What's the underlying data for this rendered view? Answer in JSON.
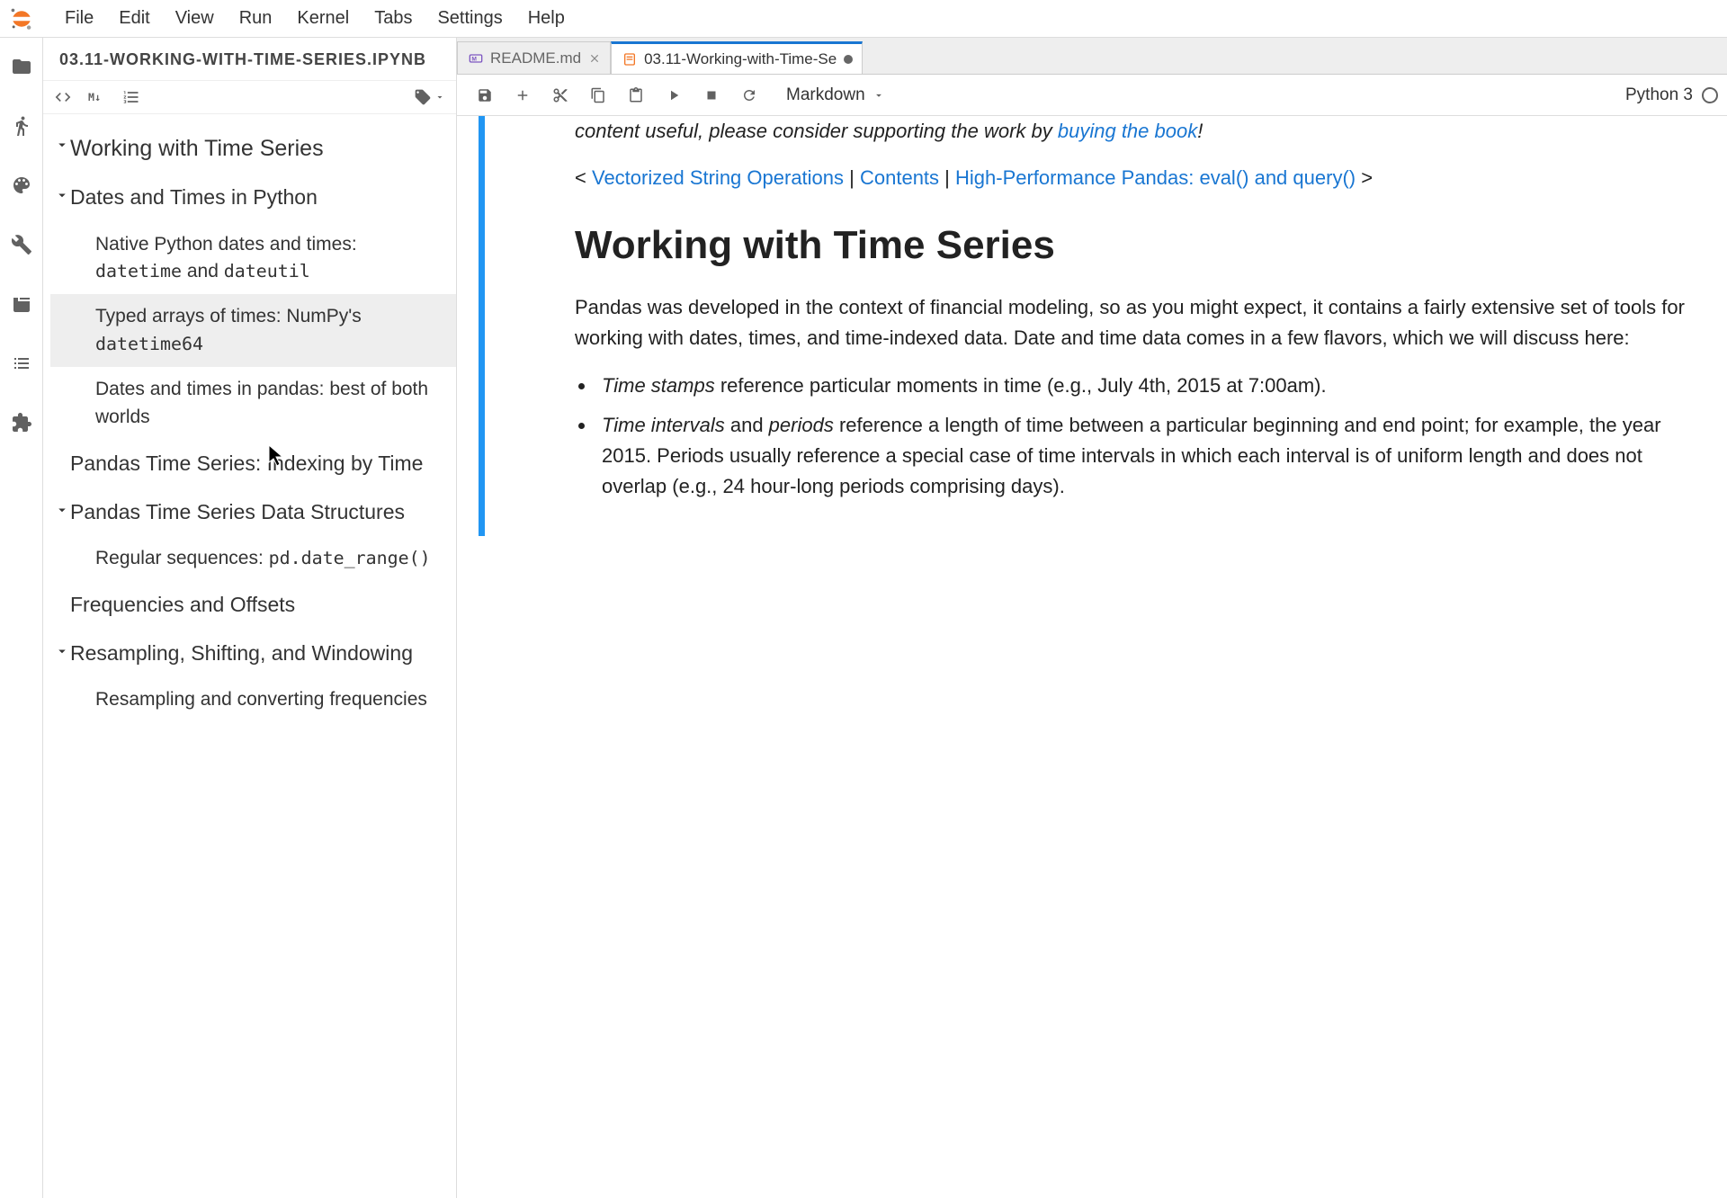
{
  "menubar": [
    "File",
    "Edit",
    "View",
    "Run",
    "Kernel",
    "Tabs",
    "Settings",
    "Help"
  ],
  "toc": {
    "title": "03.11-WORKING-WITH-TIME-SERIES.IPYNB",
    "entries": [
      {
        "level": 0,
        "caret": true,
        "html": "Working with Time Series"
      },
      {
        "level": 1,
        "caret": true,
        "html": "Dates and Times in Python"
      },
      {
        "level": 2,
        "caret": false,
        "html": "Native Python dates and times: <code class='toc-code'>datetime</code> and <code class='toc-code'>dateutil</code>"
      },
      {
        "level": 2,
        "caret": false,
        "selected": true,
        "html": "Typed arrays of times: NumPy's <code class='toc-code'>datetime64</code>"
      },
      {
        "level": 2,
        "caret": false,
        "html": "Dates and times in pandas: best of both worlds"
      },
      {
        "level": 1,
        "caret": false,
        "html": "Pandas Time Series: Indexing by Time"
      },
      {
        "level": 1,
        "caret": true,
        "html": "Pandas Time Series Data Structures"
      },
      {
        "level": 2,
        "caret": false,
        "html": "Regular sequences: <code class='toc-code'>pd.date_range()</code>"
      },
      {
        "level": 1,
        "caret": false,
        "html": "Frequencies and Offsets"
      },
      {
        "level": 1,
        "caret": true,
        "html": "Resampling, Shifting, and Windowing"
      },
      {
        "level": 2,
        "caret": false,
        "html": "Resampling and converting frequencies"
      }
    ]
  },
  "tabs": [
    {
      "id": "readme",
      "label": "README.md",
      "icon": "markdown",
      "dirty": false,
      "active": false
    },
    {
      "id": "ts",
      "label": "03.11-Working-with-Time-Se",
      "icon": "notebook",
      "dirty": true,
      "active": true
    }
  ],
  "toolbar": {
    "cell_type": "Markdown",
    "kernel": "Python 3"
  },
  "notebook": {
    "intro_tail": "content useful, please consider supporting the work by ",
    "intro_link": "buying the book",
    "nav_prev": "Vectorized String Operations",
    "nav_contents": "Contents",
    "nav_next": "High-Performance Pandas: eval() and query()",
    "h1": "Working with Time Series",
    "para1": "Pandas was developed in the context of financial modeling, so as you might expect, it contains a fairly extensive set of tools for working with dates, times, and time-indexed data. Date and time data comes in a few flavors, which we will discuss here:",
    "li1_em": "Time stamps",
    "li1_rest": " reference particular moments in time (e.g., July 4th, 2015 at 7:00am).",
    "li2_em1": "Time intervals",
    "li2_mid": " and ",
    "li2_em2": "periods",
    "li2_rest": " reference a length of time between a particular beginning and end point; for example, the year 2015. Periods usually reference a special case of time intervals in which each interval is of uniform length and does not overlap (e.g., 24 hour-long periods comprising days)."
  }
}
